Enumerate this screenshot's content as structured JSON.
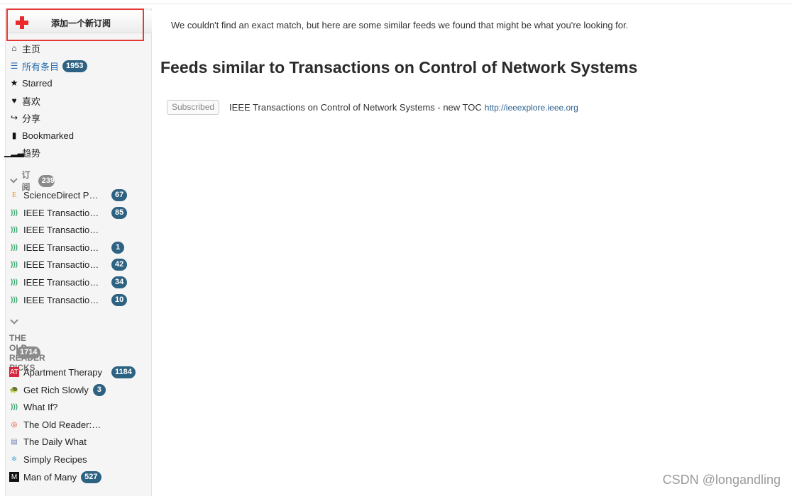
{
  "add_subscription": {
    "label": "添加一个新订阅"
  },
  "nav": [
    {
      "icon": "home-icon",
      "label": "主页",
      "badge": ""
    },
    {
      "icon": "list-icon",
      "label": "所有条目",
      "badge": "1953"
    },
    {
      "icon": "star-icon",
      "label": "Starred",
      "badge": ""
    },
    {
      "icon": "heart-icon",
      "label": "喜欢",
      "badge": ""
    },
    {
      "icon": "share-icon",
      "label": "分享",
      "badge": ""
    },
    {
      "icon": "bookmark-icon",
      "label": "Bookmarked",
      "badge": ""
    },
    {
      "icon": "trending-icon",
      "label": "趋势",
      "badge": ""
    }
  ],
  "subscriptions": {
    "label": "订阅",
    "badge": "239",
    "feeds": [
      {
        "icon": "elsevier-icon",
        "title": "ScienceDirect Publication",
        "badge": "67"
      },
      {
        "icon": "rss-icon",
        "title": "IEEE Transactions on Automatic Control",
        "badge": "85"
      },
      {
        "icon": "rss-icon",
        "title": "IEEE Transactions on Control of Network Systems",
        "badge": ""
      },
      {
        "icon": "rss-icon",
        "title": "IEEE Transactions on Cybernetics",
        "badge": "1"
      },
      {
        "icon": "rss-icon",
        "title": "IEEE Transactions on Signal Processing",
        "badge": "42"
      },
      {
        "icon": "rss-icon",
        "title": "IEEE Transactions on Neural Networks",
        "badge": "34"
      },
      {
        "icon": "rss-icon",
        "title": "IEEE Transactions on Industrial Electronics",
        "badge": "10"
      }
    ]
  },
  "picks": {
    "label": "THE OLD READER PICKS",
    "badge": "1714",
    "feeds": [
      {
        "icon": "apartment-therapy-icon",
        "title": "Apartment Therapy",
        "badge": "1184"
      },
      {
        "icon": "get-rich-slowly-icon",
        "title": "Get Rich Slowly",
        "badge": "3"
      },
      {
        "icon": "rss-icon",
        "title": "What If?",
        "badge": ""
      },
      {
        "icon": "old-reader-icon",
        "title": "The Old Reader: Blog",
        "badge": ""
      },
      {
        "icon": "daily-what-icon",
        "title": "The Daily What",
        "badge": ""
      },
      {
        "icon": "simply-recipes-icon",
        "title": "Simply Recipes",
        "badge": ""
      },
      {
        "icon": "man-of-many-icon",
        "title": "Man of Many",
        "badge": "527"
      }
    ]
  },
  "main": {
    "notice": "We couldn't find an exact match, but here are some similar feeds we found that might be what you're looking for.",
    "heading": "Feeds similar to Transactions on Control of Network Systems",
    "results": [
      {
        "button_label": "Subscribed",
        "title": "IEEE Transactions on Control of Network Systems - new TOC",
        "url": "http://ieeexplore.ieee.org"
      }
    ]
  },
  "watermark": "CSDN @longandling"
}
